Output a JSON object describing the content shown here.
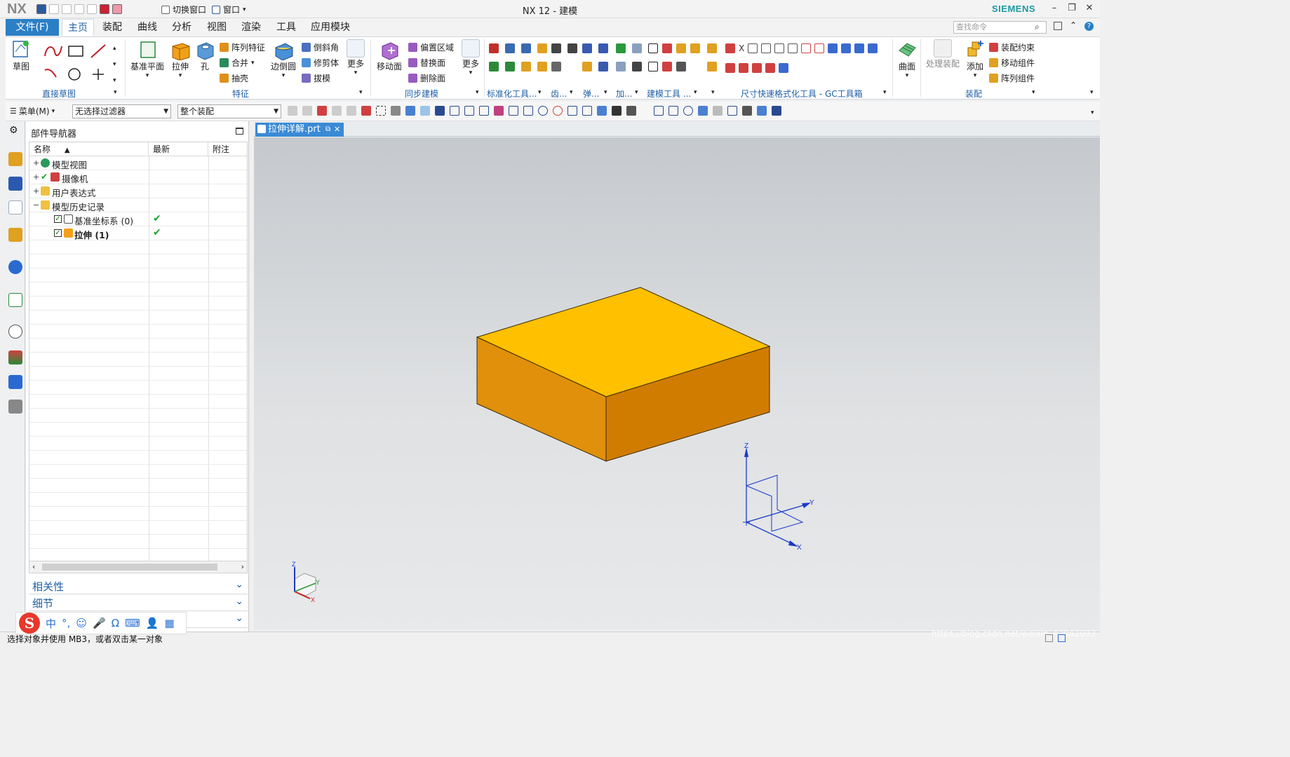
{
  "app": {
    "logo": "NX",
    "window_title": "NX 12 - 建模",
    "brand": "SIEMENS",
    "switch_window": "切换窗口",
    "window_menu": "窗口"
  },
  "colors": {
    "accent": "#2b7fc5",
    "group_label": "#1f5fa6",
    "box_top": "#ffc000",
    "box_left": "#e0900a",
    "box_right": "#d07c00",
    "brand": "#1a9aa0"
  },
  "menu_tabs": [
    "文件(F)",
    "主页",
    "装配",
    "曲线",
    "分析",
    "视图",
    "渲染",
    "工具",
    "应用模块"
  ],
  "search": {
    "placeholder": "查找命令"
  },
  "ribbon": {
    "sketch": {
      "label": "草图",
      "group": "直接草图"
    },
    "feature": {
      "datum_plane": "基准平面",
      "extrude": "拉伸",
      "hole": "孔",
      "pattern_feature": "阵列特征",
      "unite": "合并",
      "shell": "抽壳",
      "edge_blend": "边倒圆",
      "chamfer": "倒斜角",
      "trim_body": "修剪体",
      "draft": "拔模",
      "more": "更多",
      "group": "特征"
    },
    "sync": {
      "move_face": "移动面",
      "offset_region": "偏置区域",
      "replace_face": "替换面",
      "delete_face": "删除面",
      "more": "更多",
      "group": "同步建模"
    },
    "groups_misc": [
      "标准化工具...",
      "齿...",
      "弹...",
      "加...",
      "建模工具 ...",
      "尺寸快速格式化工具 - GC工具箱"
    ],
    "surface": {
      "label": "曲面"
    },
    "assembly": {
      "process": "处理装配",
      "add": "添加",
      "constraint": "装配约束",
      "move_component": "移动组件",
      "pattern_component": "阵列组件",
      "group": "装配"
    }
  },
  "toolbar2": {
    "menu": "菜单(M)",
    "filter": "无选择过滤器",
    "scope": "整个装配"
  },
  "navigator": {
    "title": "部件导航器",
    "columns": [
      "名称",
      "最新",
      "附注"
    ],
    "nodes": [
      {
        "label": "模型视图",
        "expander": "+",
        "bold": false
      },
      {
        "label": "摄像机",
        "expander": "+",
        "bold": false
      },
      {
        "label": "用户表达式",
        "expander": "+",
        "bold": false
      },
      {
        "label": "模型历史记录",
        "expander": "−",
        "bold": false
      },
      {
        "label": "基准坐标系 (0)",
        "expander": "",
        "bold": false,
        "latest": "✔"
      },
      {
        "label": "拉伸 (1)",
        "expander": "",
        "bold": true,
        "latest": "✔"
      }
    ],
    "panels": [
      "相关性",
      "细节",
      ""
    ]
  },
  "document": {
    "tab": "拉伸详解.prt"
  },
  "viewport": {
    "axes_labels": {
      "z": "Z",
      "y": "Y",
      "x": "X"
    }
  },
  "status": {
    "text": "选择对象并使用 MB3，或者双击某一对象"
  },
  "watermark": "https://blog.csdn.net/weixin_42042093",
  "ime": {
    "chars": [
      "中",
      "°,",
      "☺",
      "🎤",
      "Ω",
      "⌨",
      "👤",
      "▦"
    ]
  }
}
